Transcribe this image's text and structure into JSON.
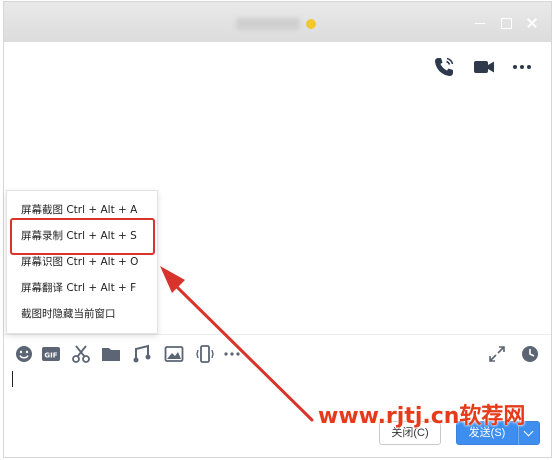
{
  "window": {
    "colors": {
      "titlebar": "#dcdcdc",
      "accent": "#3e8ef0",
      "highlight": "#d9342b",
      "watermark": "#e63b1b"
    }
  },
  "header_icons": [
    "phone-call-icon",
    "video-call-icon",
    "more-icon"
  ],
  "toolbar": {
    "left_icons": [
      "emoji-icon",
      "gif-icon",
      "scissors-screenshot-icon",
      "folder-icon",
      "music-icon",
      "image-icon",
      "shake-icon",
      "more-icon"
    ],
    "right_icons": [
      "expand-icon",
      "history-icon"
    ]
  },
  "screenshot_menu": {
    "items": [
      {
        "label": "屏幕截图 Ctrl + Alt + A"
      },
      {
        "label": "屏幕录制 Ctrl + Alt + S",
        "highlighted": true
      },
      {
        "label": "屏幕识图 Ctrl + Alt + O"
      },
      {
        "label": "屏幕翻译 Ctrl + Alt + F"
      },
      {
        "label": "截图时隐藏当前窗口"
      }
    ]
  },
  "buttons": {
    "close_label": "关闭(C)",
    "send_label": "发送(S)"
  },
  "watermark": "www.rjtj.cn软荐网"
}
